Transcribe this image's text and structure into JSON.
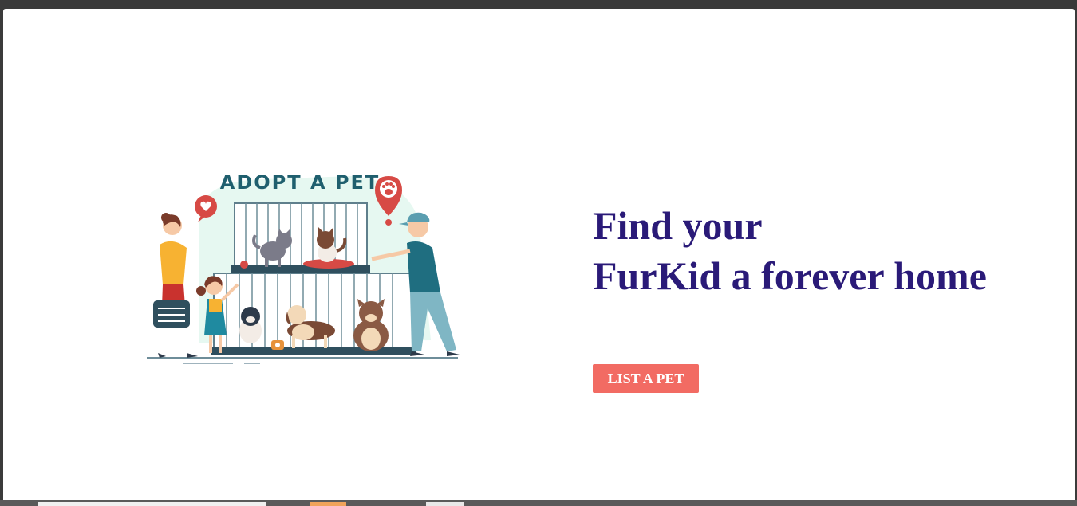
{
  "hero": {
    "illustration": {
      "title": "ADOPT A PET",
      "icons": [
        "heart-bubble-icon",
        "paw-location-pin-icon"
      ]
    },
    "headline_line1": "Find your",
    "headline_line2": "FurKid a forever home",
    "cta_label": "LIST A PET"
  },
  "colors": {
    "headline": "#2a1a78",
    "cta_background": "#f26b63",
    "cta_text": "#ffffff",
    "illustration_title": "#1f5f6e"
  }
}
